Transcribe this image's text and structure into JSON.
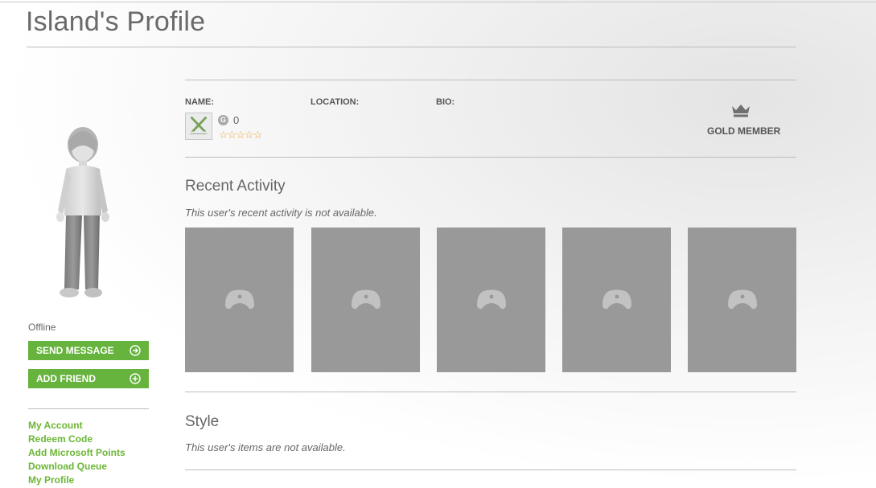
{
  "header": {
    "title": "Island's Profile"
  },
  "profile": {
    "name_label": "NAME:",
    "location_label": "LOCATION:",
    "bio_label": "BIO:",
    "gamerscore_badge": "G",
    "gamerscore": "0",
    "reputation_stars": "☆☆☆☆☆",
    "reputation_value": 0,
    "membership": "GOLD MEMBER",
    "presence": "Offline"
  },
  "actions": {
    "send_message": "SEND MESSAGE",
    "add_friend": "ADD FRIEND"
  },
  "sidebar_links": [
    {
      "label": "My Account"
    },
    {
      "label": "Redeem Code"
    },
    {
      "label": "Add Microsoft Points"
    },
    {
      "label": "Download Queue"
    },
    {
      "label": "My Profile"
    }
  ],
  "recent_activity": {
    "title": "Recent Activity",
    "message": "This user's recent activity is not available.",
    "tile_icon": "controller-icon",
    "tile_count": 5
  },
  "style_section": {
    "title": "Style",
    "message": "This user's items are not available."
  },
  "colors": {
    "accent_green": "#66b33d",
    "link_green": "#6bb634",
    "star_orange": "#f0a030",
    "tile_gray": "#999999"
  }
}
